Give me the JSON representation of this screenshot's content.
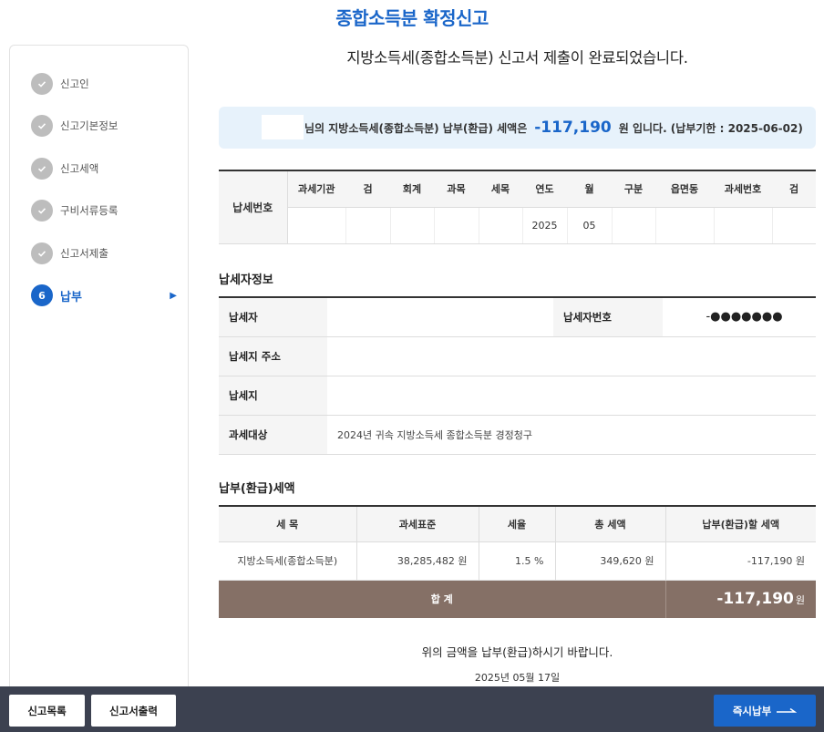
{
  "page": {
    "title": "종합소득분 확정신고"
  },
  "sidebar": {
    "steps": [
      {
        "number": "",
        "label": "신고인",
        "icon": "check-icon",
        "active": false
      },
      {
        "number": "",
        "label": "신고기본정보",
        "icon": "check-icon",
        "active": false
      },
      {
        "number": "",
        "label": "신고세액",
        "icon": "check-icon",
        "active": false
      },
      {
        "number": "",
        "label": "구비서류등록",
        "icon": "check-icon",
        "active": false
      },
      {
        "number": "",
        "label": "신고서제출",
        "icon": "check-icon",
        "active": false
      },
      {
        "number": "6",
        "label": "납부",
        "icon": "caret-right-icon",
        "active": true
      }
    ]
  },
  "headline": "지방소득세(종합소득분) 신고서 제출이 완료되었습니다.",
  "notice": {
    "prefix": "님의 지방소득세(종합소득분) 납부(환급) 세액은",
    "amount": "-117,190",
    "suffix": "원 입니다. (납부기한 : 2025-06-02)"
  },
  "tax_number": {
    "row_label": "납세번호",
    "headers": [
      "과세기관",
      "검",
      "회계",
      "과목",
      "세목",
      "연도",
      "월",
      "구분",
      "읍면동",
      "과세번호",
      "검"
    ],
    "values": [
      "",
      "",
      "",
      "",
      "",
      "2025",
      "05",
      "",
      "",
      "",
      ""
    ]
  },
  "payer_section": {
    "title": "납세자정보",
    "payer_label": "납세자",
    "payer_value": "",
    "payer_no_label": "납세자번호",
    "payer_no_value": "-●●●●●●●",
    "address_label": "납세지 주소",
    "address_value": "",
    "place_label": "납세지",
    "place_value": "",
    "target_label": "과세대상",
    "target_value": "2024년 귀속 지방소득세 종합소득분 경정청구"
  },
  "tax_section": {
    "title": "납부(환급)세액",
    "headers": [
      "세 목",
      "과세표준",
      "세율",
      "총 세액",
      "납부(환급)할 세액"
    ],
    "rows": [
      [
        "지방소득세(종합소득분)",
        "38,285,482 원",
        "1.5 %",
        "349,620 원",
        "-117,190 원"
      ]
    ],
    "total_label": "합 계",
    "total_amount": "-117,190",
    "total_unit": "원"
  },
  "closing": "위의 금액을 납부(환급)하시기 바랍니다.",
  "date": "2025년 05월 17일",
  "footer": {
    "list_label": "신고목록",
    "print_label": "신고서출력",
    "pay_label": "즉시납부",
    "pay_icon": "arrow-right-icon"
  },
  "colors": {
    "accent": "#1a66c9",
    "total_bg": "#857066",
    "footer_bg": "#3c4150",
    "notice_bg": "#e7f2fb"
  }
}
